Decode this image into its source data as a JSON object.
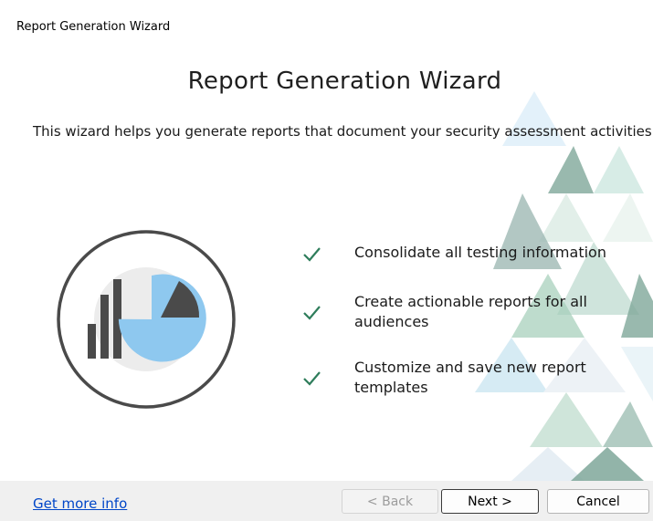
{
  "window": {
    "title": "Report Generation Wizard"
  },
  "main": {
    "heading": "Report Generation Wizard",
    "subheading": "This wizard helps you generate reports that document your security assessment activities",
    "features": [
      {
        "line1": "Consolidate all testing information",
        "line2": ""
      },
      {
        "line1": "Create actionable reports for all",
        "line2": "audiences"
      },
      {
        "line1": "Customize and save new report",
        "line2": "templates"
      }
    ],
    "illustration_icon": "report-chart-icon",
    "check_icon": "checkmark-icon"
  },
  "footer": {
    "more_info_link": "Get more info",
    "back_label": "< Back",
    "back_enabled": false,
    "next_label": "Next >",
    "cancel_label": "Cancel"
  },
  "colors": {
    "check": "#2e7d5b",
    "pie_fill": "#8ec8ef",
    "bar_fill": "#4a4a4a",
    "link": "#0046c8",
    "footer_bg": "#f0f0f0"
  }
}
